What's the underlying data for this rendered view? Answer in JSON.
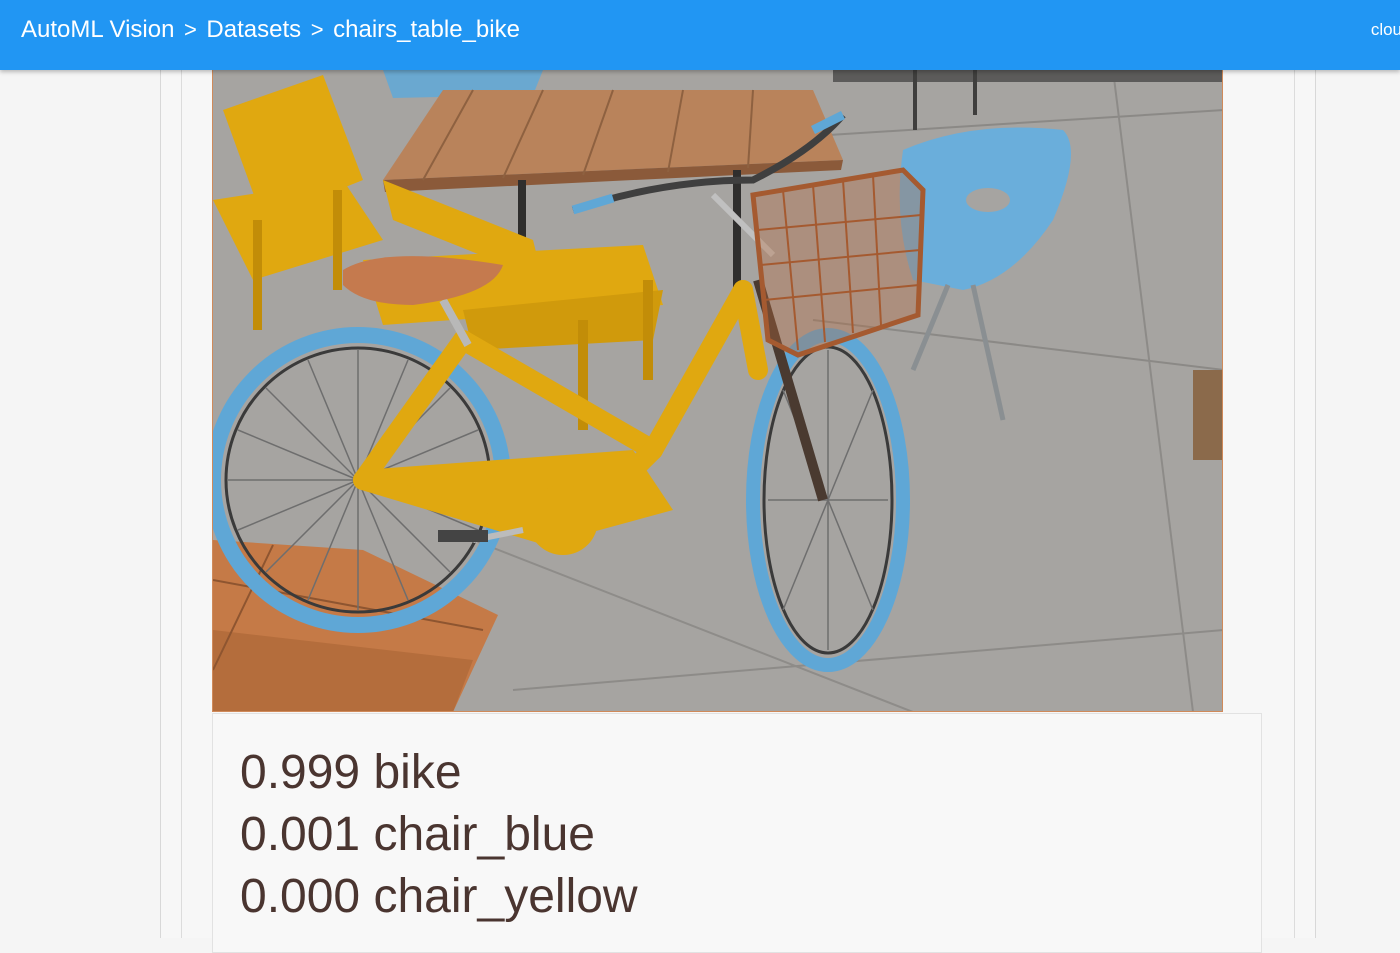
{
  "header": {
    "breadcrumbs": [
      "AutoML Vision",
      "Datasets",
      "chairs_table_bike"
    ],
    "separator": ">",
    "right_text": "clou"
  },
  "image": {
    "subject": "yellow bike with brown basket, yellow chairs, blue chair, wooden tables on concrete patio"
  },
  "predictions": [
    {
      "score": "0.999",
      "label": "bike"
    },
    {
      "score": "0.001",
      "label": "chair_blue"
    },
    {
      "score": "0.000",
      "label": "chair_yellow"
    }
  ],
  "colors": {
    "header_bg": "#2196f3",
    "prediction_text": "#4a3530",
    "bike_yellow": "#e0a810",
    "chair_blue": "#5fa7d6",
    "wood": "#c57a47"
  }
}
